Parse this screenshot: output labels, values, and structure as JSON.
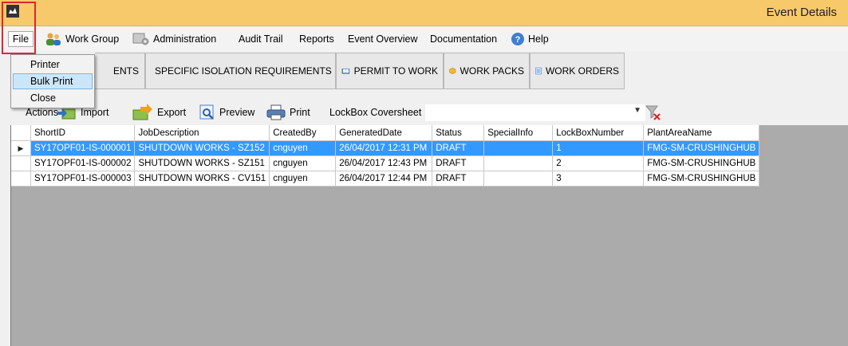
{
  "window": {
    "title": "Event Details"
  },
  "menu": {
    "file": "File",
    "work_group": "Work Group",
    "administration": "Administration",
    "audit_trail": "Audit Trail",
    "reports": "Reports",
    "event_overview": "Event Overview",
    "documentation": "Documentation",
    "help": "Help"
  },
  "file_menu": {
    "printer": "Printer",
    "bulk_print": "Bulk Print",
    "close": "Close"
  },
  "tabs": {
    "partial": "ENTS",
    "specific_isolation": "SPECIFIC ISOLATION REQUIREMENTS",
    "permit_to_work": "PERMIT TO WORK",
    "work_packs": "WORK PACKS",
    "work_orders": "WORK ORDERS"
  },
  "toolbar": {
    "actions": "Actions",
    "import": "Import",
    "export": "Export",
    "preview": "Preview",
    "print": "Print",
    "lockbox_label": "LockBox Coversheet",
    "lockbox_value": ""
  },
  "grid": {
    "columns": [
      "ShortID",
      "JobDescription",
      "CreatedBy",
      "GeneratedDate",
      "Status",
      "SpecialInfo",
      "LockBoxNumber",
      "PlantAreaName"
    ],
    "rows": [
      [
        "SY17OPF01-IS-000001",
        "SHUTDOWN WORKS - SZ152",
        "cnguyen",
        "26/04/2017 12:31 PM",
        "DRAFT",
        "",
        "1",
        "FMG-SM-CRUSHINGHUB"
      ],
      [
        "SY17OPF01-IS-000002",
        "SHUTDOWN WORKS - SZ151",
        "cnguyen",
        "26/04/2017 12:43 PM",
        "DRAFT",
        "",
        "2",
        "FMG-SM-CRUSHINGHUB"
      ],
      [
        "SY17OPF01-IS-000003",
        "SHUTDOWN WORKS - CV151",
        "cnguyen",
        "26/04/2017 12:44 PM",
        "DRAFT",
        "",
        "3",
        "FMG-SM-CRUSHINGHUB"
      ]
    ]
  },
  "colors": {
    "titlebar": "#f7c96a",
    "selection": "#3399ff",
    "highlight_border": "#e0262c",
    "grid_bg": "#ababab"
  }
}
